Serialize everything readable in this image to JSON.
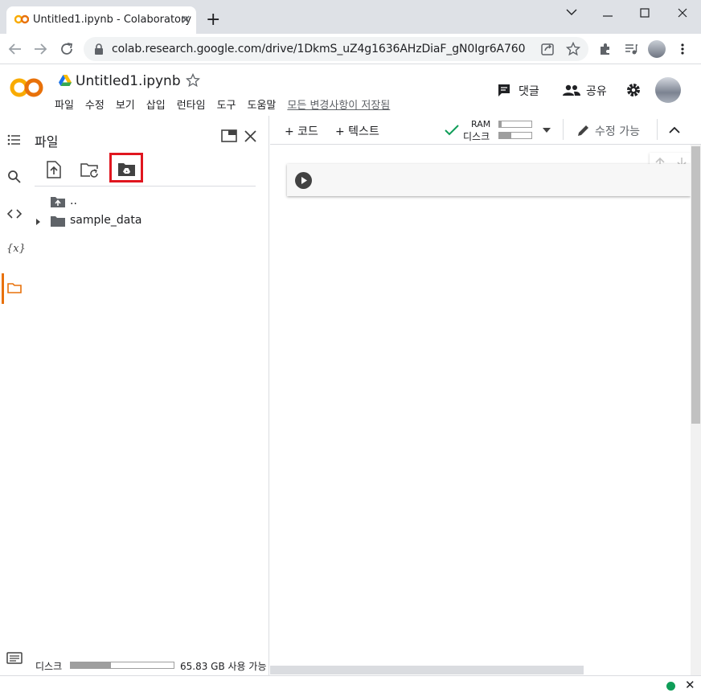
{
  "browser": {
    "tab_title": "Untitled1.ipynb - Colaboratory",
    "tab_close": "✕",
    "new_tab": "+",
    "url": "colab.research.google.com/drive/1DkmS_uZ4g1636AHzDiaF_gN0Igr6A760"
  },
  "colab": {
    "notebook_title": "Untitled1.ipynb",
    "menu": [
      "파일",
      "수정",
      "보기",
      "삽입",
      "런타임",
      "도구",
      "도움말"
    ],
    "save_status": "모든 변경사항이 저장됨",
    "comment_label": "댓글",
    "share_label": "공유"
  },
  "files_panel": {
    "title": "파일",
    "parent_dir": "..",
    "items": [
      {
        "name": "sample_data",
        "type": "folder"
      }
    ],
    "disk_label": "디스크",
    "disk_free": "65.83 GB 사용 가능",
    "disk_used_fraction": 0.39
  },
  "toolbar": {
    "add_code": "+ 코드",
    "add_text": "+ 텍스트",
    "ram_label": "RAM",
    "disk_label": "디스크",
    "edit_mode": "수정 가능"
  },
  "status": {
    "close": "✕"
  },
  "colors": {
    "colab_orange": "#e8710a",
    "colab_yellow": "#f9ab00",
    "highlight_red": "#e0161f",
    "check_green": "#0f9d58"
  }
}
